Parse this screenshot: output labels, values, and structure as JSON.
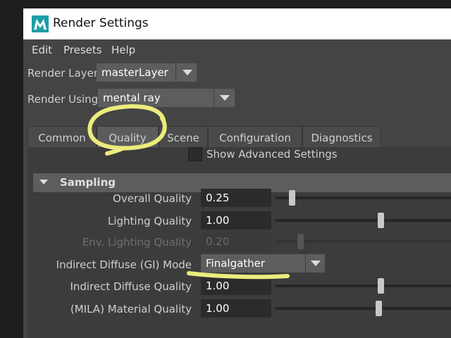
{
  "window": {
    "title": "Render Settings"
  },
  "menu": [
    "Edit",
    "Presets",
    "Help"
  ],
  "render_layer": {
    "label": "Render Layer",
    "value": "masterLayer"
  },
  "render_using": {
    "label": "Render Using",
    "value": "mental ray"
  },
  "tabs": [
    {
      "label": "Common",
      "active": false
    },
    {
      "label": "Quality",
      "active": true
    },
    {
      "label": "Scene",
      "active": false
    },
    {
      "label": "Configuration",
      "active": false
    },
    {
      "label": "Diagnostics",
      "active": false
    }
  ],
  "show_advanced": {
    "label": "Show Advanced Settings",
    "checked": false
  },
  "section": {
    "title": "Sampling",
    "expanded": true
  },
  "rows": [
    {
      "label": "Overall Quality",
      "value": "0.25",
      "slider_fraction": 0.08,
      "enabled": true
    },
    {
      "label": "Lighting Quality",
      "value": "1.00",
      "slider_fraction": 0.6,
      "enabled": true
    },
    {
      "label": "Env. Lighting Quality",
      "value": "0.20",
      "slider_fraction": 0.13,
      "enabled": false
    },
    {
      "label": "Indirect Diffuse (GI) Mode",
      "value": "Finalgather",
      "type": "dropdown",
      "enabled": true
    },
    {
      "label": "Indirect Diffuse Quality",
      "value": "1.00",
      "slider_fraction": 0.6,
      "enabled": true
    },
    {
      "label": "(MILA) Material Quality",
      "value": "1.00",
      "slider_fraction": 0.59,
      "enabled": true
    }
  ],
  "colors": {
    "annotation": "#ecec7c",
    "panel": "#444444",
    "field": "#2b2b2b"
  }
}
